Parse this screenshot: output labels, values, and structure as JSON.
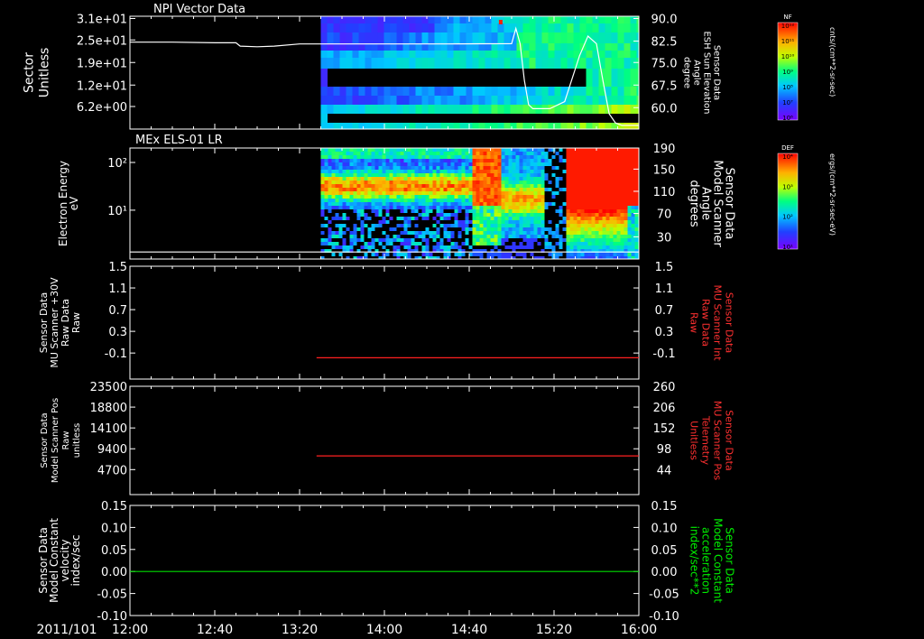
{
  "date_label": "2011/101",
  "time_axis": {
    "ticks": [
      "12:00",
      "12:40",
      "13:20",
      "14:00",
      "14:40",
      "15:20",
      "16:00"
    ],
    "range_minutes": [
      0,
      240
    ]
  },
  "chart_data": [
    {
      "id": "panel1",
      "type": "heatmap",
      "title": "NPI Vector Data",
      "ylabel": [
        "Sector",
        "Unitless"
      ],
      "yticks": [
        "3.1e+01",
        "2.5e+01",
        "1.9e+01",
        "1.2e+01",
        "6.2e+00"
      ],
      "right_ylabel": [
        "Sensor Data",
        "ESH Sun Elevation",
        "Angle",
        "degree"
      ],
      "right_yticks": [
        "90.0",
        "82.5",
        "75.0",
        "67.5",
        "60.0"
      ],
      "right_ylim": [
        53,
        90
      ],
      "data_start_minute": 90,
      "line_color": "#ffffff",
      "line_series": {
        "name": "ESH Sun Elevation Angle",
        "x": [
          0,
          20,
          40,
          50,
          52,
          60,
          68,
          80,
          100,
          150,
          180,
          182,
          184,
          186,
          188,
          190,
          194,
          198,
          205,
          212,
          216,
          220,
          223,
          226,
          229,
          232,
          240
        ],
        "y": [
          81.5,
          81.5,
          81.3,
          81.3,
          80.2,
          80.0,
          80.2,
          80.9,
          80.9,
          80.9,
          81.0,
          86.0,
          81.0,
          69.0,
          61.0,
          59.7,
          59.7,
          59.7,
          62.0,
          77.0,
          83.5,
          81.0,
          69.0,
          58.0,
          55.0,
          54.2,
          54.2
        ]
      },
      "colorbar": {
        "label": "NF",
        "unit": "cnts/(cm**2-sr-sec)",
        "tick_labels": [
          "10¹²",
          "10¹¹",
          "10¹⁰",
          "10⁹",
          "10⁸",
          "10⁷",
          "10⁶"
        ]
      }
    },
    {
      "id": "panel2",
      "type": "heatmap",
      "title": "MEx ELS-01 LR",
      "ylabel": [
        "Electron Energy",
        "eV"
      ],
      "yticks": [
        "10²",
        "10¹"
      ],
      "right_ylabel": [
        "Sensor Data",
        "Model Scanner",
        "Angle",
        "degrees"
      ],
      "right_yticks": [
        "190",
        "150",
        "110",
        "70",
        "30"
      ],
      "right_ylim": [
        0,
        190
      ],
      "data_start_minute": 90,
      "line_color": "#ffffff",
      "line_series": {
        "name": "Model Scanner Angle",
        "x": [
          0,
          240
        ],
        "y": [
          12,
          12
        ]
      },
      "colorbar": {
        "label": "DEF",
        "unit": "ergs/(cm**2-sr-sec-eV)",
        "tick_labels": [
          "10⁴",
          "10³",
          "10²",
          "10¹"
        ]
      }
    },
    {
      "id": "panel3",
      "type": "line",
      "ylabel": [
        "Sensor Data",
        "MU Scanner +30V",
        "Raw Data",
        "Raw"
      ],
      "yticks": [
        "1.5",
        "1.1",
        "0.7",
        "0.3",
        "-0.1"
      ],
      "ylim": [
        -0.35,
        1.5
      ],
      "right_ylabel": [
        "Sensor Data",
        "MU Scanner Int",
        "Raw Data",
        "Raw"
      ],
      "right_yticks": [
        "1.5",
        "1.1",
        "0.7",
        "0.3",
        "-0.1"
      ],
      "right_color": "#ff3030",
      "line_color": "#ff2020",
      "series": [
        {
          "name": "MU Scanner Int",
          "x": [
            88,
            240
          ],
          "y": [
            0.0,
            0.0
          ]
        }
      ]
    },
    {
      "id": "panel4",
      "type": "line",
      "ylabel": [
        "Sensor Data",
        "Model Scanner Pos",
        "Raw",
        "unitless"
      ],
      "yticks": [
        "23500",
        "18800",
        "14100",
        "9400",
        "4700"
      ],
      "ylim": [
        0,
        23500
      ],
      "right_ylabel": [
        "Sensor Data",
        "MU Scanner Pos",
        "Telemetry",
        "Unitless"
      ],
      "right_yticks": [
        "260",
        "206",
        "152",
        "98",
        "44"
      ],
      "right_color": "#ff3030",
      "line_color": "#ff2020",
      "series": [
        {
          "name": "MU Scanner Pos",
          "x": [
            88,
            240
          ],
          "y": [
            8400,
            8400
          ]
        }
      ]
    },
    {
      "id": "panel5",
      "type": "line",
      "ylabel": [
        "Sensor Data",
        "Model Constant",
        "velocity",
        "index/sec"
      ],
      "yticks": [
        "0.15",
        "0.10",
        "0.05",
        "0.00",
        "-0.05",
        "-0.10"
      ],
      "ylim": [
        -0.1,
        0.15
      ],
      "right_ylabel": [
        "Sensor Data",
        "Model Constant",
        "acceleration",
        "index/sec**2"
      ],
      "right_yticks": [
        "0.15",
        "0.10",
        "0.05",
        "0.00",
        "-0.05",
        "-0.10"
      ],
      "right_color": "#00ee00",
      "line_color": "#00dd00",
      "series": [
        {
          "name": "Model Constant acceleration",
          "x": [
            0,
            240
          ],
          "y": [
            0.0,
            0.0
          ]
        }
      ]
    }
  ]
}
